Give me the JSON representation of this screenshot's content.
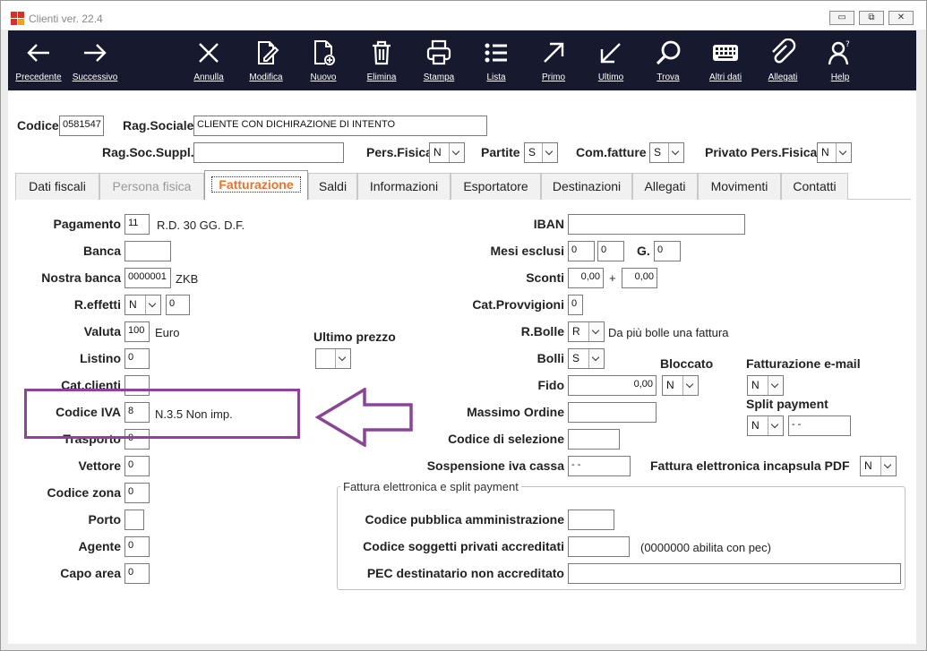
{
  "window": {
    "title": "Clienti ver. 22.4"
  },
  "window_controls": {
    "minimize": "▭",
    "restore": "⧉",
    "close": "✕"
  },
  "toolbar": [
    {
      "label": "Precedente",
      "icon": "arrow-left-icon"
    },
    {
      "label": "Successivo",
      "icon": "arrow-right-icon"
    },
    {
      "label": "Annulla",
      "icon": "close-icon"
    },
    {
      "label": "Modifica",
      "icon": "edit-document-icon"
    },
    {
      "label": "Nuovo",
      "icon": "new-document-icon"
    },
    {
      "label": "Elimina",
      "icon": "trash-icon"
    },
    {
      "label": "Stampa",
      "icon": "printer-icon"
    },
    {
      "label": "Lista",
      "icon": "list-icon"
    },
    {
      "label": "Primo",
      "icon": "arrow-up-right-icon"
    },
    {
      "label": "Ultimo",
      "icon": "arrow-down-left-icon"
    },
    {
      "label": "Trova",
      "icon": "search-icon"
    },
    {
      "label": "Altri dati",
      "icon": "keyboard-icon"
    },
    {
      "label": "Allegati",
      "icon": "paperclip-icon"
    },
    {
      "label": "Help",
      "icon": "help-user-icon"
    }
  ],
  "header": {
    "codice_label": "Codice",
    "codice_value": "0581547",
    "ragsociale_label": "Rag.Sociale",
    "ragsociale_value": "CLIENTE CON DICHIRAZIONE DI INTENTO",
    "ragsocsuppl_label": "Rag.Soc.Suppl.",
    "ragsocsuppl_value": "",
    "persfisica_label": "Pers.Fisica",
    "persfisica_value": "N",
    "partite_label": "Partite",
    "partite_value": "S",
    "comfatture_label": "Com.fatture",
    "comfatture_value": "S",
    "privato_label": "Privato Pers.Fisica",
    "privato_value": "N"
  },
  "tabs": [
    {
      "label": "Dati fiscali",
      "state": "normal"
    },
    {
      "label": "Persona fisica",
      "state": "disabled"
    },
    {
      "label": "Fatturazione",
      "state": "active"
    },
    {
      "label": "Saldi",
      "state": "normal"
    },
    {
      "label": "Informazioni",
      "state": "normal"
    },
    {
      "label": "Esportatore",
      "state": "normal"
    },
    {
      "label": "Destinazioni",
      "state": "normal"
    },
    {
      "label": "Allegati",
      "state": "normal"
    },
    {
      "label": "Movimenti",
      "state": "normal"
    },
    {
      "label": "Contatti",
      "state": "normal"
    }
  ],
  "left": {
    "pagamento_label": "Pagamento",
    "pagamento_value": "11",
    "pagamento_desc": "R.D. 30 GG. D.F.",
    "banca_label": "Banca",
    "banca_value": "",
    "nostrabanca_label": "Nostra banca",
    "nostrabanca_value": "0000001",
    "nostrabanca_desc": "ZKB",
    "reffetti_label": "R.effetti",
    "reffetti_value": "N",
    "reffetti_num": "0",
    "valuta_label": "Valuta",
    "valuta_value": "100",
    "valuta_desc": "Euro",
    "listino_label": "Listino",
    "listino_value": "0",
    "catclienti_label": "Cat.clienti",
    "catclienti_value": "",
    "codiceiva_label": "Codice IVA",
    "codiceiva_value": "8",
    "codiceiva_desc": "N.3.5 Non imp.",
    "trasporto_label": "Trasporto",
    "trasporto_value": "0",
    "vettore_label": "Vettore",
    "vettore_value": "0",
    "codicezona_label": "Codice zona",
    "codicezona_value": "0",
    "porto_label": "Porto",
    "porto_value": "",
    "agente_label": "Agente",
    "agente_value": "0",
    "capoarea_label": "Capo area",
    "capoarea_value": "0"
  },
  "middle": {
    "ultimoprezzo_label": "Ultimo prezzo",
    "ultimoprezzo_value": ""
  },
  "right": {
    "iban_label": "IBAN",
    "iban_value": "",
    "mesiesclusi_label": "Mesi esclusi",
    "mesiesclusi_value1": "0",
    "mesiesclusi_value2": "0",
    "g_label": "G.",
    "g_value": "0",
    "sconti_label": "Sconti",
    "sconti_value1": "0,00",
    "sconti_plus": "+",
    "sconti_value2": "0,00",
    "catprovvigioni_label": "Cat.Provvigioni",
    "catprovvigioni_value": "0",
    "rbolle_label": "R.Bolle",
    "rbolle_value": "R",
    "rbolle_desc": "Da più bolle una fattura",
    "bolli_label": "Bolli",
    "bolli_value": "S",
    "bloccato_label": "Bloccato",
    "bloccato_value": "N",
    "fido_label": "Fido",
    "fido_value": "0,00",
    "fattemail_label": "Fatturazione e-mail",
    "fattemail_value": "N",
    "splitpayment_label": "Split payment",
    "splitpayment_value": "N",
    "splitpayment_date": "- -",
    "massimoordine_label": "Massimo Ordine",
    "massimoordine_value": "",
    "codiceselezione_label": "Codice di selezione",
    "codiceselezione_value": "",
    "sospensione_label": "Sospensione iva cassa",
    "sospensione_value": "- -",
    "fatturapdf_label": "Fattura elettronica incapsula PDF",
    "fatturapdf_value": "N"
  },
  "einvoice_group": {
    "title": "Fattura elettronica e split payment",
    "codicepa_label": "Codice pubblica amministrazione",
    "codicepa_value": "",
    "codiceprivati_label": "Codice soggetti privati accreditati",
    "codiceprivati_value": "",
    "codiceprivati_note": "(0000000 abilita con pec)",
    "pec_label": "PEC destinatario non accreditato",
    "pec_value": ""
  },
  "annotation": {
    "color": "#8a4596"
  },
  "colors": {
    "toolbar_bg": "#171a2f",
    "active_tab": "#e8742a"
  }
}
